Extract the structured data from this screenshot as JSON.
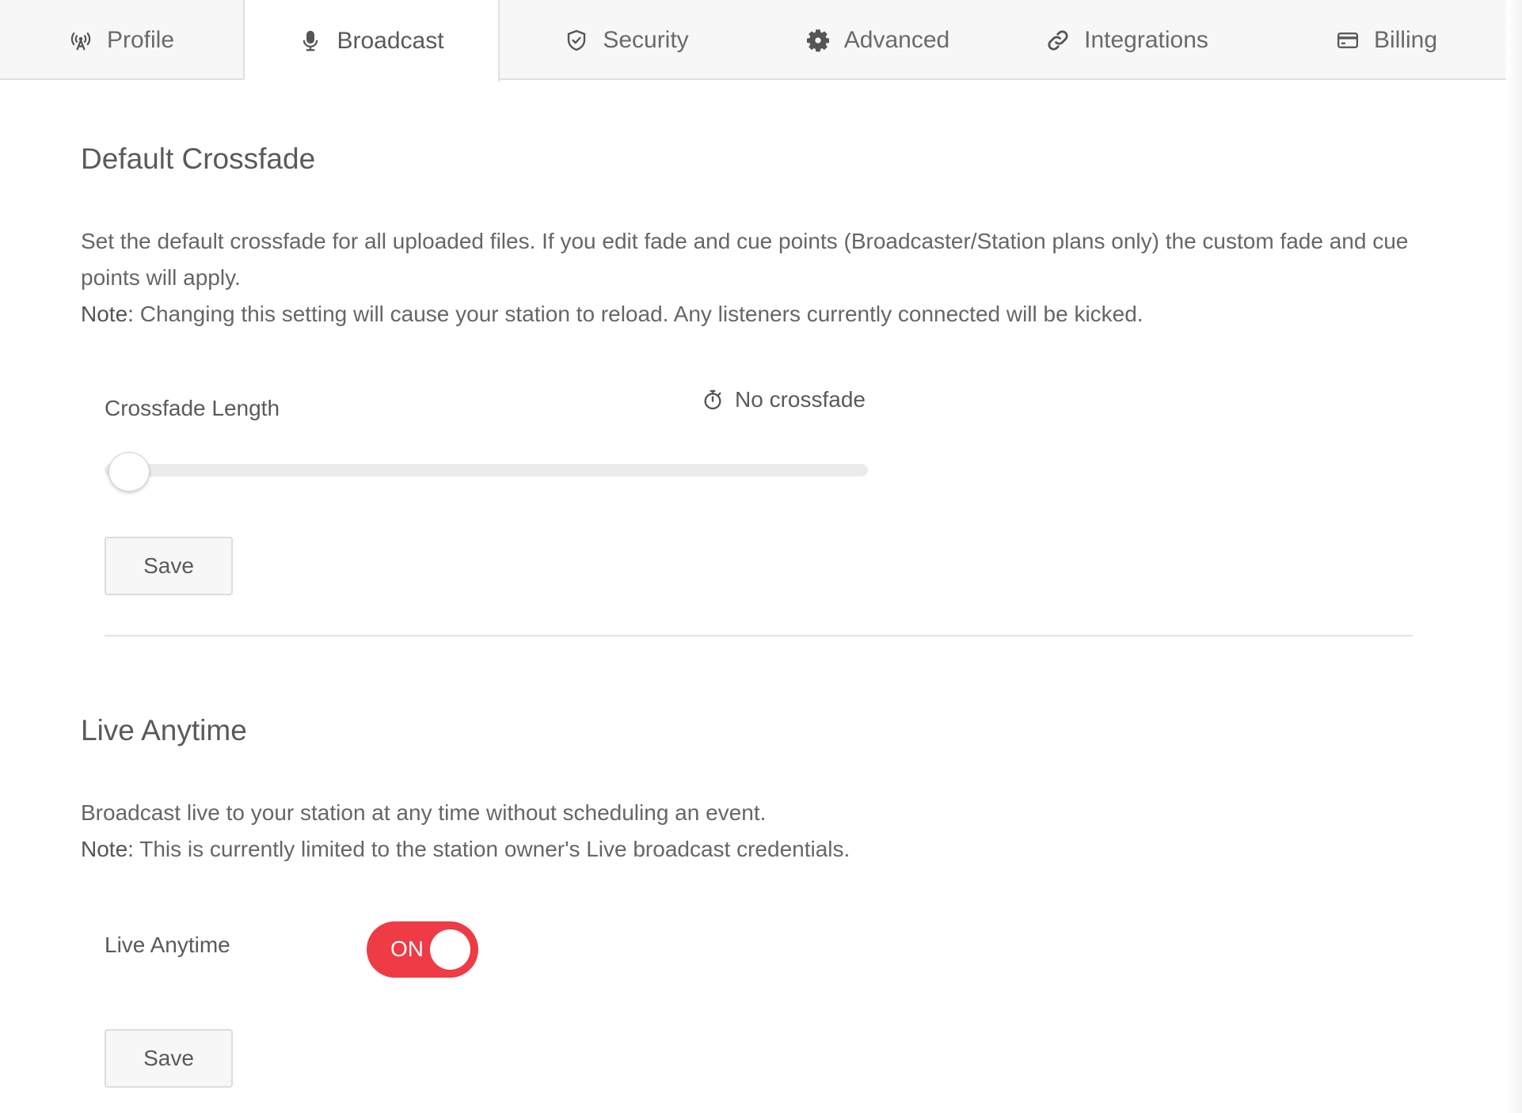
{
  "tabs": [
    {
      "label": "Profile",
      "icon": "broadcast-tower-icon"
    },
    {
      "label": "Broadcast",
      "icon": "microphone-icon",
      "active": true
    },
    {
      "label": "Security",
      "icon": "shield-check-icon"
    },
    {
      "label": "Advanced",
      "icon": "gear-icon"
    },
    {
      "label": "Integrations",
      "icon": "link-icon"
    },
    {
      "label": "Billing",
      "icon": "credit-card-icon"
    }
  ],
  "crossfade": {
    "title": "Default Crossfade",
    "description": "Set the default crossfade for all uploaded files. If you edit fade and cue points (Broadcaster/Station plans only) the custom fade and cue points will apply.",
    "note_label": "Note:",
    "note_text": " Changing this setting will cause your station to reload. Any listeners currently connected will be kicked.",
    "field_label": "Crossfade Length",
    "status_icon": "stopwatch-icon",
    "status_text": "No crossfade",
    "slider_value": 0,
    "save_label": "Save"
  },
  "live_anytime": {
    "title": "Live Anytime",
    "description": "Broadcast live to your station at any time without scheduling an event.",
    "note_label": "Note:",
    "note_text": " This is currently limited to the station owner's Live broadcast credentials.",
    "field_label": "Live Anytime",
    "toggle_label": "ON",
    "toggle_on": true,
    "save_label": "Save"
  },
  "colors": {
    "accent": "#ee3b45",
    "tab_bar_bg": "#f7f7f7",
    "text": "#5a5a5a"
  }
}
